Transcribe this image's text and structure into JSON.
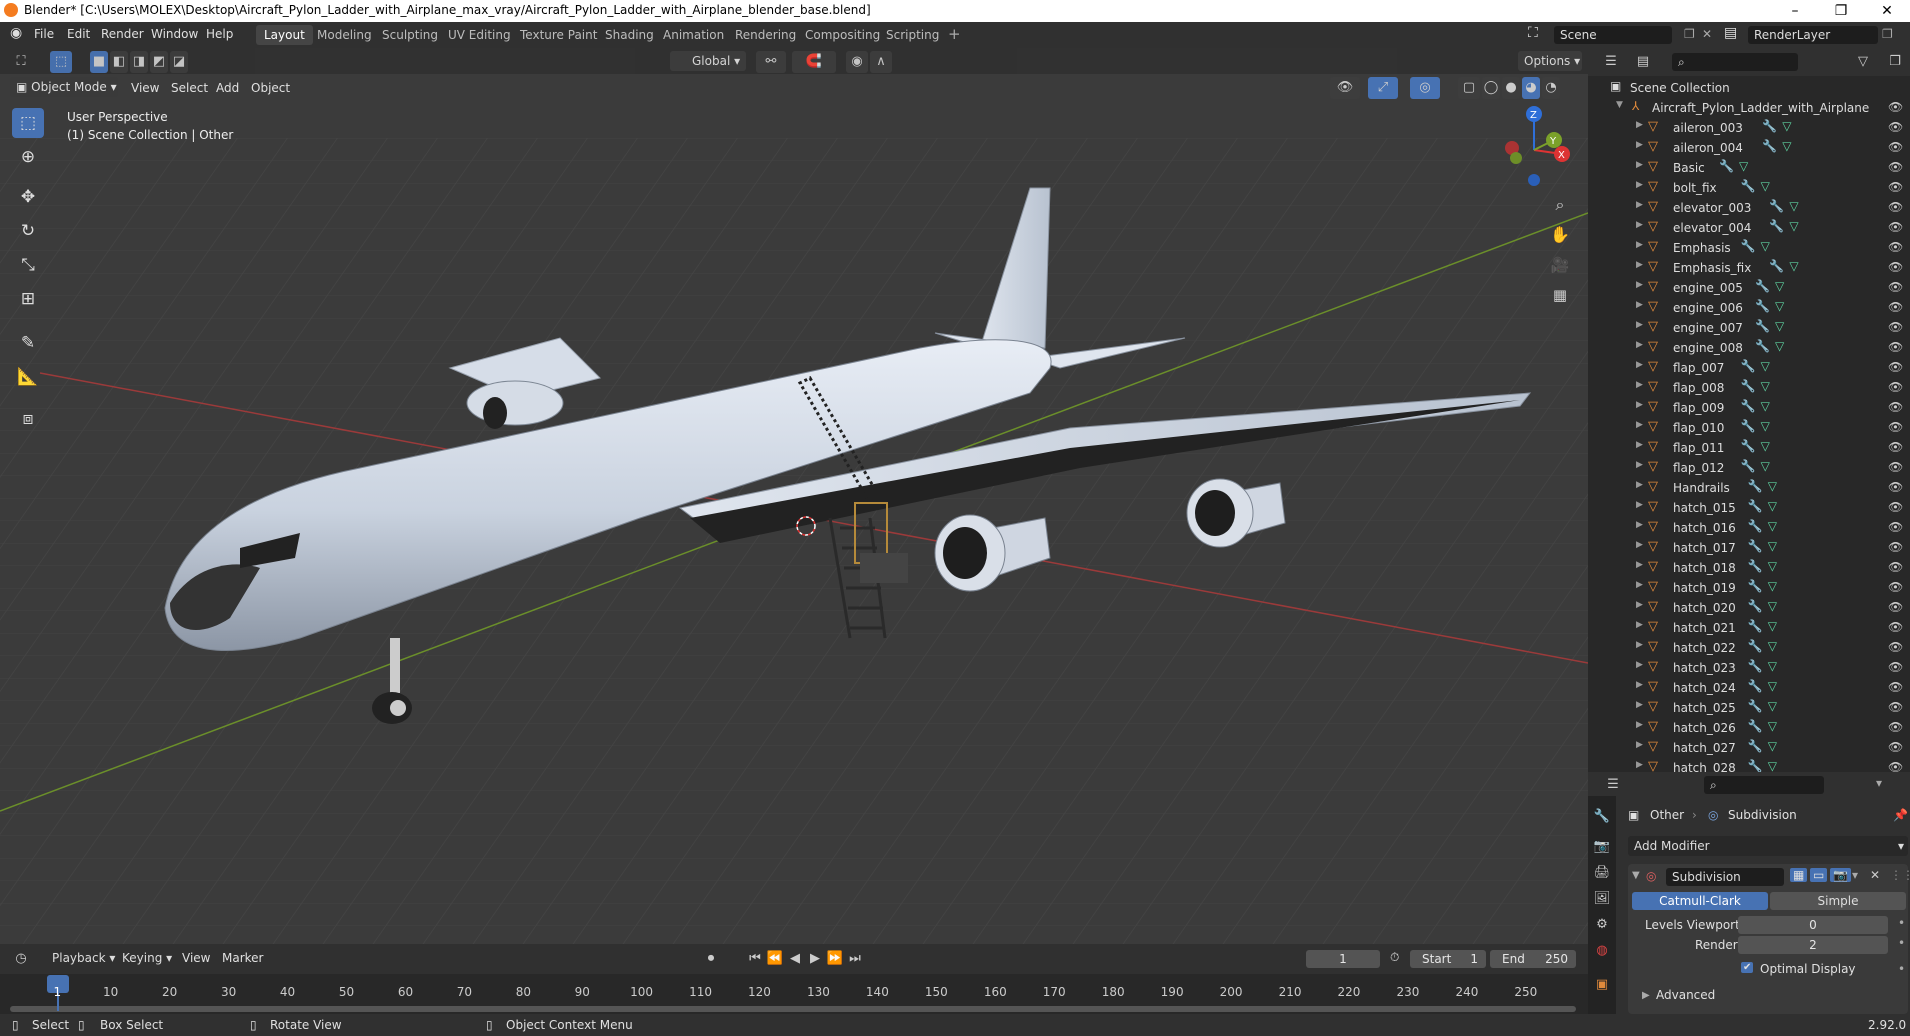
{
  "title": "Blender* [C:\\Users\\MOLEX\\Desktop\\Aircraft_Pylon_Ladder_with_Airplane_max_vray/Aircraft_Pylon_Ladder_with_Airplane_blender_base.blend]",
  "menu": [
    "File",
    "Edit",
    "Render",
    "Window",
    "Help"
  ],
  "workspaces": [
    "Layout",
    "Modeling",
    "Sculpting",
    "UV Editing",
    "Texture Paint",
    "Shading",
    "Animation",
    "Rendering",
    "Compositing",
    "Scripting"
  ],
  "scene": "Scene",
  "renderlayer": "RenderLayer",
  "header": {
    "mode": "Object Mode",
    "view": "View",
    "select": "Select",
    "add": "Add",
    "object": "Object",
    "orientation": "Global",
    "options": "Options"
  },
  "overlay": {
    "line1": "User Perspective",
    "line2": "(1) Scene Collection | Other"
  },
  "outliner": {
    "scene_collection": "Scene Collection",
    "root": "Aircraft_Pylon_Ladder_with_Airplane",
    "items": [
      "aileron_003",
      "aileron_004",
      "Basic",
      "bolt_fix",
      "elevator_003",
      "elevator_004",
      "Emphasis",
      "Emphasis_fix",
      "engine_005",
      "engine_006",
      "engine_007",
      "engine_008",
      "flap_007",
      "flap_008",
      "flap_009",
      "flap_010",
      "flap_011",
      "flap_012",
      "Handrails",
      "hatch_015",
      "hatch_016",
      "hatch_017",
      "hatch_018",
      "hatch_019",
      "hatch_020",
      "hatch_021",
      "hatch_022",
      "hatch_023",
      "hatch_024",
      "hatch_025",
      "hatch_026",
      "hatch_027",
      "hatch_028"
    ]
  },
  "properties": {
    "breadcrumb_obj": "Other",
    "breadcrumb_mod": "Subdivision",
    "add_modifier": "Add Modifier",
    "modifier_name": "Subdivision",
    "catmull": "Catmull-Clark",
    "simple": "Simple",
    "levels_label": "Levels Viewport",
    "levels_value": "0",
    "render_label": "Render",
    "render_value": "2",
    "optimal": "Optimal Display",
    "advanced": "Advanced"
  },
  "timeline": {
    "playback": "Playback",
    "keying": "Keying",
    "view": "View",
    "marker": "Marker",
    "current": "1",
    "start_label": "Start",
    "start": "1",
    "end_label": "End",
    "end": "250",
    "ticks": [
      "1",
      "10",
      "20",
      "30",
      "40",
      "50",
      "60",
      "70",
      "80",
      "90",
      "100",
      "110",
      "120",
      "130",
      "140",
      "150",
      "160",
      "170",
      "180",
      "190",
      "200",
      "210",
      "220",
      "230",
      "240",
      "250"
    ]
  },
  "status": {
    "select": "Select",
    "box": "Box Select",
    "rotate": "Rotate View",
    "context": "Object Context Menu",
    "version": "2.92.0"
  }
}
